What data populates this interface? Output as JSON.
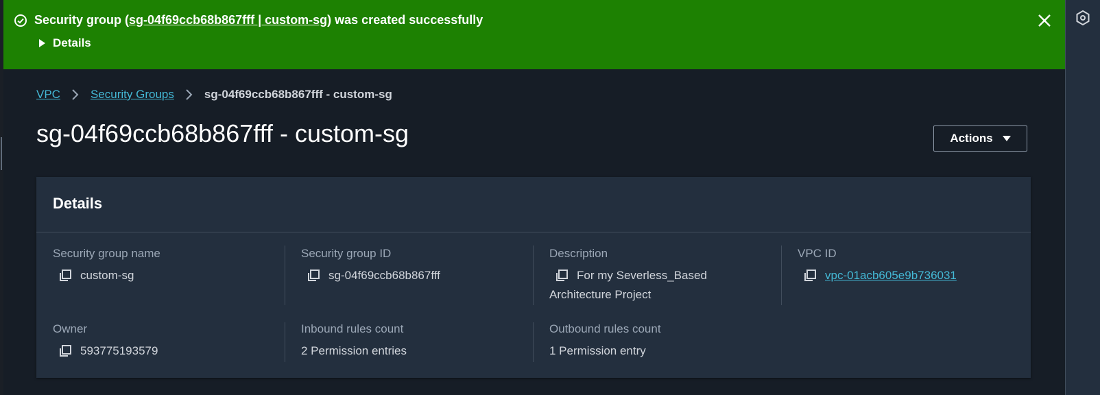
{
  "flash": {
    "prefix": "Security group (",
    "link": "sg-04f69ccb68b867fff | custom-sg",
    "suffix": ") was created successfully",
    "details": "Details"
  },
  "breadcrumb": [
    "VPC",
    "Security Groups",
    "sg-04f69ccb68b867fff - custom-sg"
  ],
  "title": "sg-04f69ccb68b867fff - custom-sg",
  "actions_label": "Actions",
  "details": {
    "heading": "Details",
    "name_label": "Security group name",
    "name_value": "custom-sg",
    "id_label": "Security group ID",
    "id_value": "sg-04f69ccb68b867fff",
    "desc_label": "Description",
    "desc_line1": "For my Severless_Based",
    "desc_line2": "Architecture Project",
    "vpc_label": "VPC ID",
    "vpc_value": "vpc-01acb605e9b736031",
    "owner_label": "Owner",
    "owner_value": "593775193579",
    "inbound_label": "Inbound rules count",
    "inbound_value": "2 Permission entries",
    "outbound_label": "Outbound rules count",
    "outbound_value": "1 Permission entry"
  },
  "icons": [
    "check-circle-icon",
    "close-icon",
    "chevron-right-icon",
    "caret-down-icon",
    "copy-icon",
    "hexagon-settings-icon"
  ],
  "colors": {
    "success": "#1d8102",
    "link": "#44b9d6",
    "panel": "#232f3e"
  }
}
